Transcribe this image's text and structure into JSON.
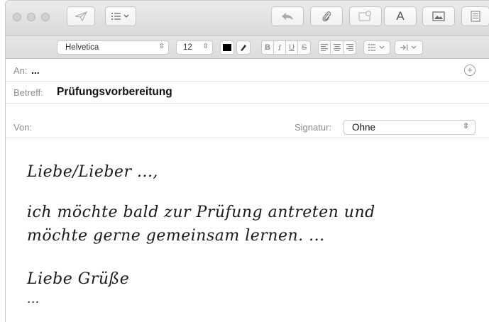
{
  "toolbar": {
    "traffic_lights": [
      "close-button",
      "minimize-button",
      "zoom-button"
    ],
    "send_icon": "paper-plane-icon",
    "header_fields_icon": "list-icon",
    "reply_icon": "reply-arrow-icon",
    "attach_icon": "paperclip-icon",
    "markup_icon": "markup-icon",
    "format_label": "A",
    "photo_icon": "photo-icon",
    "template_icon": "stationery-icon"
  },
  "formatbar": {
    "font": "Helvetica",
    "size": "12",
    "color": "#000000",
    "bold": "B",
    "italic": "I",
    "underline": "U",
    "strike": "S",
    "align_icons": [
      "align-left-icon",
      "align-center-icon",
      "align-right-icon"
    ],
    "list_icon": "bullet-list-icon",
    "indent_icon": "indent-icon"
  },
  "header": {
    "to_label": "An:",
    "to_value": "...",
    "subject_label": "Betreff:",
    "subject_value": "Prüfungsvorbereitung",
    "from_label": "Von:",
    "signature_label": "Signatur:",
    "signature_value": "Ohne"
  },
  "body": {
    "greeting": "Liebe/Lieber ...,",
    "line1": "ich möchte bald zur Prüfung antreten und",
    "line2": "möchte gerne gemeinsam lernen. ...",
    "closing": "Liebe Grüße",
    "signature": "..."
  }
}
